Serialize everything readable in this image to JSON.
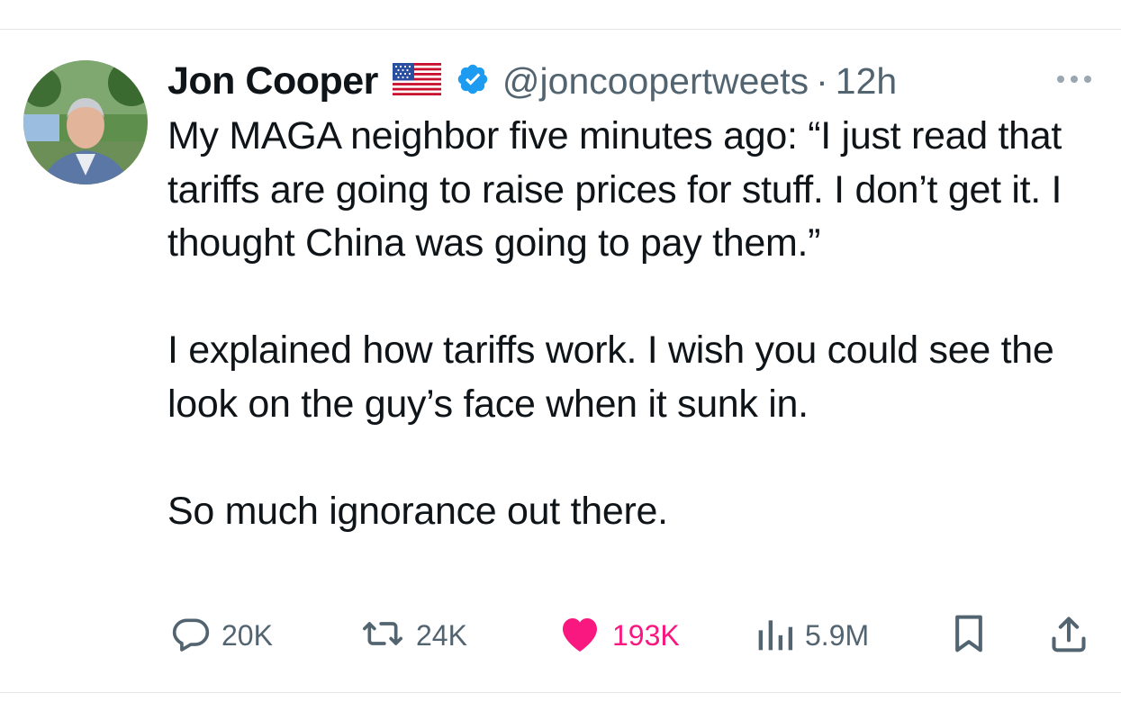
{
  "tweet": {
    "author": {
      "name": "Jon Cooper",
      "handle": "@joncoopertweets",
      "flag": "us-flag",
      "verified": true,
      "verified_color": "#1d9bf0"
    },
    "separator": "·",
    "timestamp": "12h",
    "paragraphs": [
      "My MAGA neighbor five minutes ago: “I just read that tariffs are going to raise prices for stuff. I don’t get it. I thought China was going to pay them.”",
      "I explained how tariffs work. I wish you could see the look on the guy’s face when it sunk in.",
      "So much ignorance out there."
    ],
    "actions": {
      "replies": "20K",
      "reposts": "24K",
      "likes": "193K",
      "views": "5.9M"
    },
    "colors": {
      "text": "#0f1419",
      "secondary": "#536471",
      "like": "#f91880"
    },
    "icons": [
      "reply-icon",
      "repost-icon",
      "like-icon",
      "views-icon",
      "bookmark-icon",
      "share-icon",
      "more-icon"
    ]
  }
}
